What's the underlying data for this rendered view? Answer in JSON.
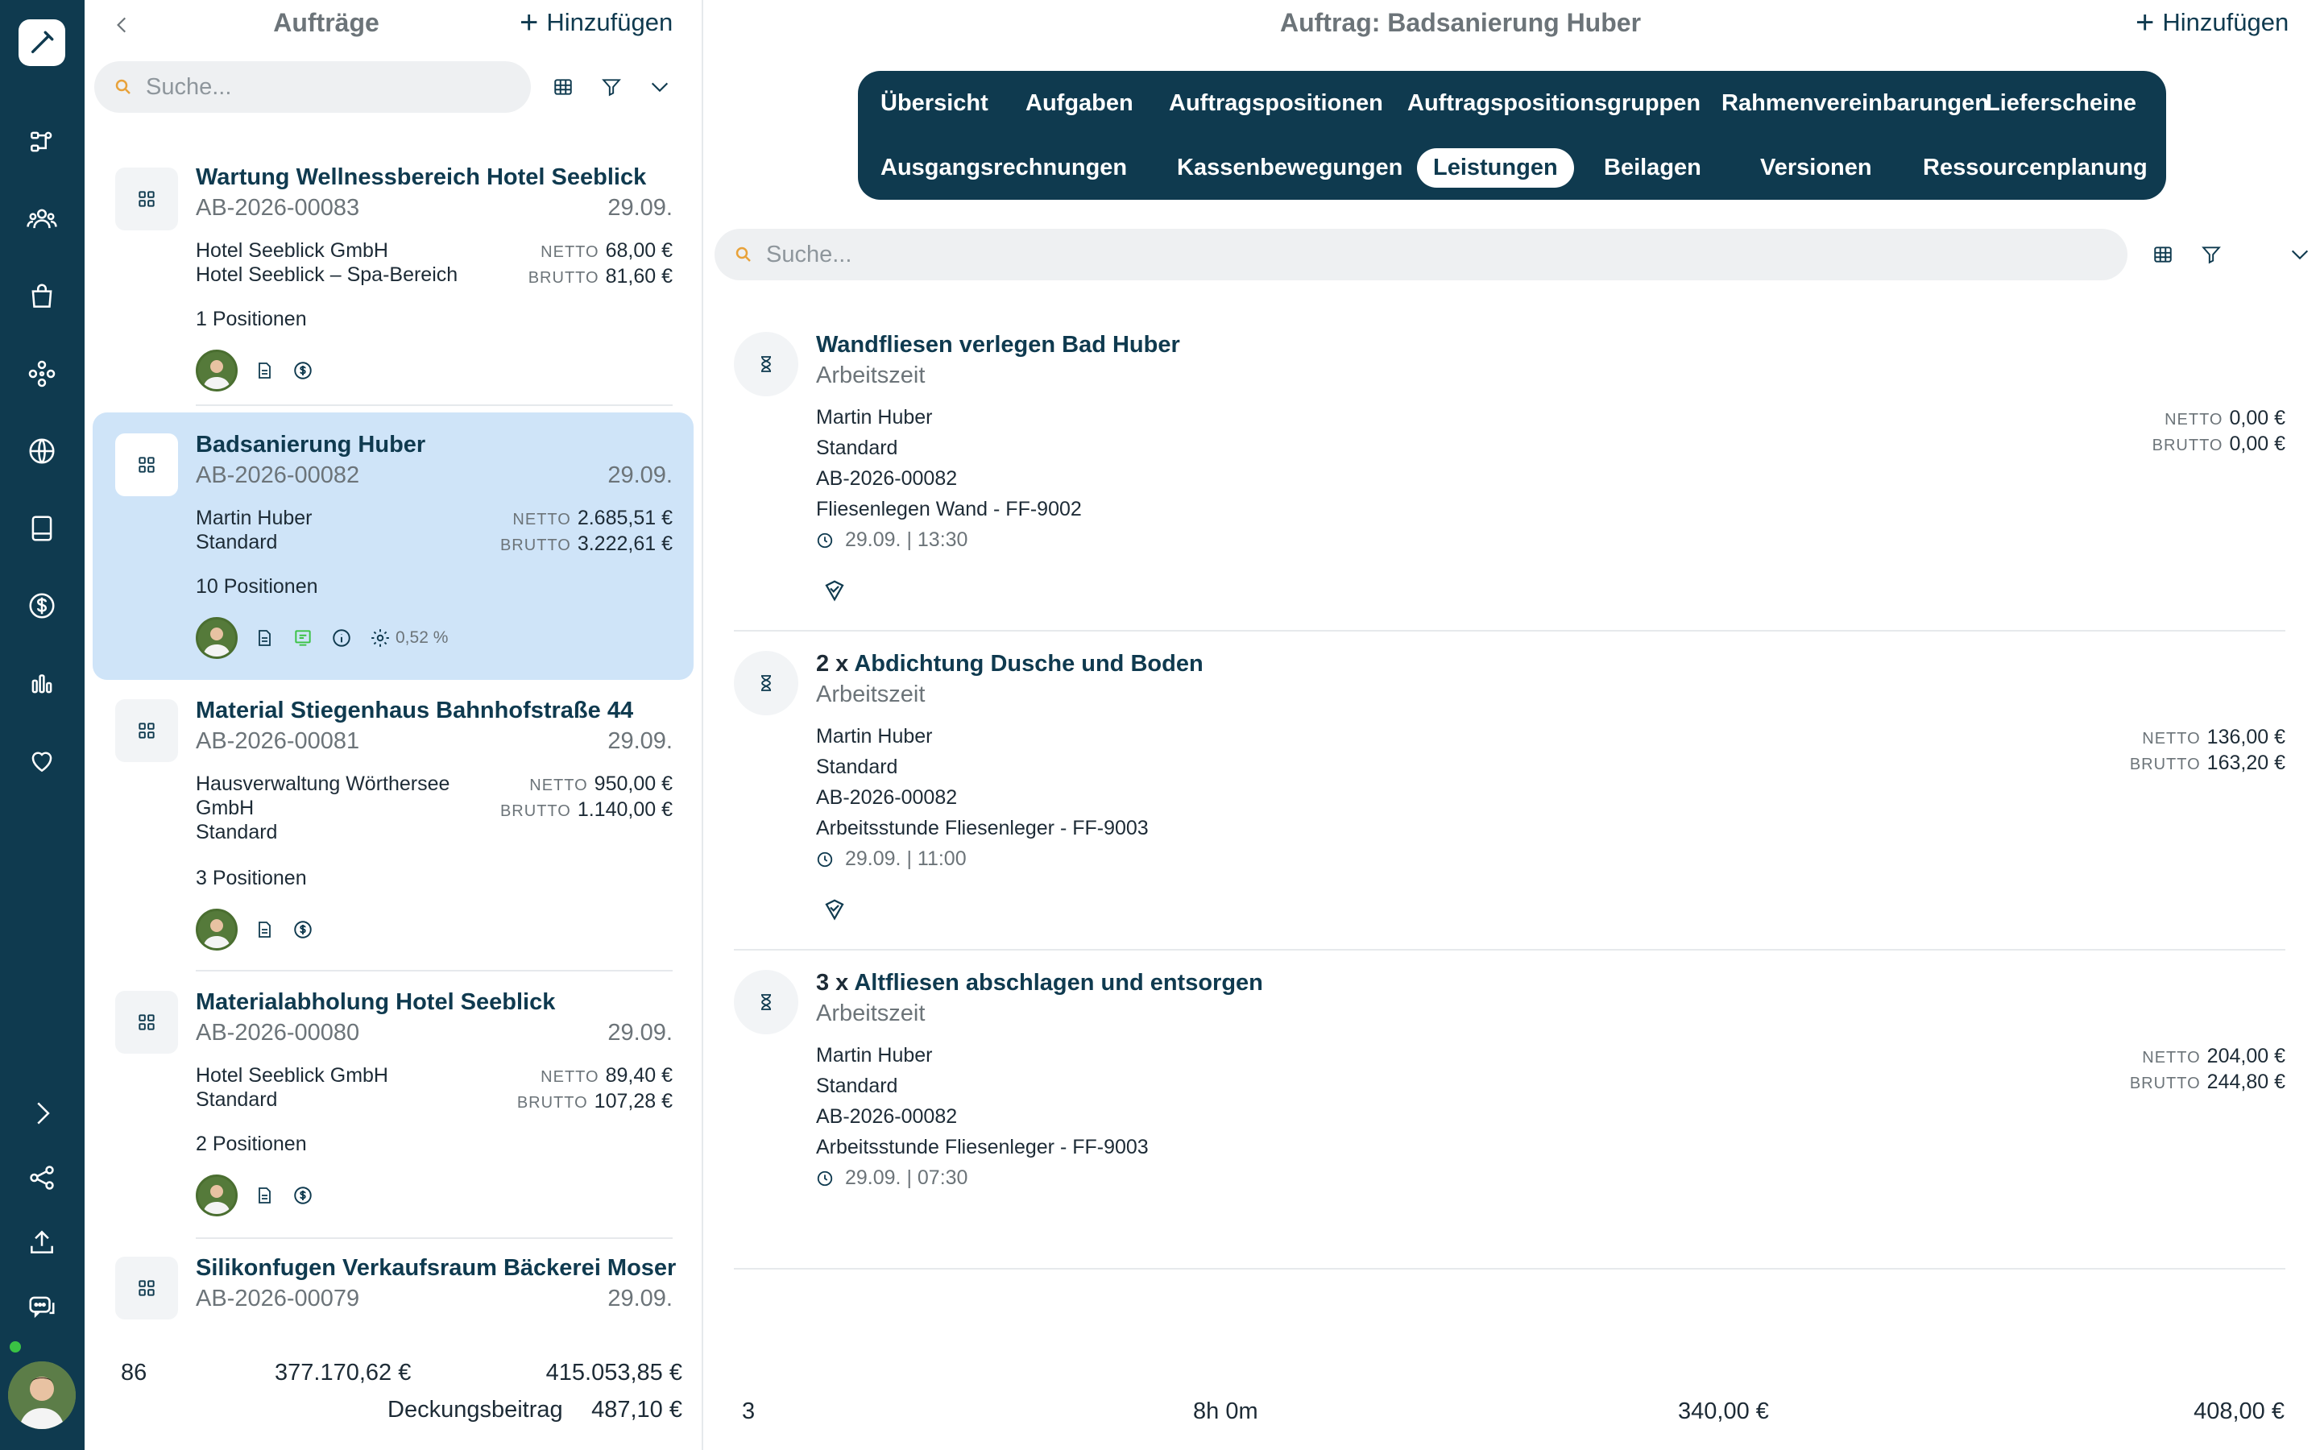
{
  "rail": {
    "icons": [
      "edit-icon",
      "workflow-icon",
      "users-icon",
      "bag-icon",
      "modules-icon",
      "globe-icon",
      "document-icon",
      "dollar-icon",
      "chart-icon",
      "heart-icon"
    ],
    "bottom_icons": [
      "expand-icon",
      "share-icon",
      "upload-icon",
      "chat-icon"
    ]
  },
  "list": {
    "title": "Aufträge",
    "add_label": "Hinzufügen",
    "search_placeholder": "Suche...",
    "orders": [
      {
        "title": "Wartung Wellnessbereich Hotel Seeblick",
        "number": "AB-2026-00083",
        "date": "29.09.",
        "lines": [
          "Hotel Seeblick GmbH",
          "Hotel Seeblick – Spa-Bereich"
        ],
        "netto": "68,00 €",
        "brutto": "81,60 €",
        "positions": "1 Positionen"
      },
      {
        "title": "Badsanierung Huber",
        "number": "AB-2026-00082",
        "date": "29.09.",
        "lines": [
          "Martin Huber",
          "Standard"
        ],
        "netto": "2.685,51 €",
        "brutto": "3.222,61 €",
        "positions": "10 Positionen",
        "percent": "0,52 %"
      },
      {
        "title": "Material Stiegenhaus Bahnhofstraße 44",
        "number": "AB-2026-00081",
        "date": "29.09.",
        "lines": [
          "Hausverwaltung Wörthersee",
          "GmbH",
          "Standard"
        ],
        "netto": "950,00 €",
        "brutto": "1.140,00 €",
        "positions": "3 Positionen"
      },
      {
        "title": "Materialabholung Hotel Seeblick",
        "number": "AB-2026-00080",
        "date": "29.09.",
        "lines": [
          "Hotel Seeblick GmbH",
          "Standard"
        ],
        "netto": "89,40 €",
        "brutto": "107,28 €",
        "positions": "2 Positionen"
      },
      {
        "title": "Silikonfugen Verkaufsraum Bäckerei Moser",
        "number": "AB-2026-00079",
        "date": "29.09."
      }
    ],
    "labels": {
      "netto": "NETTO",
      "brutto": "BRUTTO"
    },
    "footer": {
      "count": "86",
      "netto_total": "377.170,62 €",
      "brutto_total": "415.053,85 €",
      "margin_label": "Deckungsbeitrag",
      "margin_value": "487,10 €"
    }
  },
  "detail": {
    "title": "Auftrag: Badsanierung Huber",
    "add_label": "Hinzufügen",
    "search_placeholder": "Suche...",
    "tabs_row1": [
      "Übersicht",
      "Aufgaben",
      "Auftragspositionen",
      "Auftragspositionsgruppen",
      "Rahmenvereinbarungen",
      "Lieferscheine"
    ],
    "tabs_row2": [
      "Ausgangsrechnungen",
      "Kassenbewegungen",
      "Leistungen",
      "Beilagen",
      "Versionen",
      "Ressourcenplanung"
    ],
    "active_tab": "Leistungen",
    "entries": [
      {
        "qty": "",
        "title": "Wandfliesen verlegen Bad Huber",
        "type": "Arbeitszeit",
        "person": "Martin Huber",
        "variant": "Standard",
        "order": "AB-2026-00082",
        "article": "Fliesenlegen Wand - FF-9002",
        "time": "29.09. | 13:30",
        "netto": "0,00 €",
        "brutto": "0,00 €"
      },
      {
        "qty": "2 x",
        "title": "Abdichtung Dusche und Boden",
        "type": "Arbeitszeit",
        "person": "Martin Huber",
        "variant": "Standard",
        "order": "AB-2026-00082",
        "article": "Arbeitsstunde Fliesenleger - FF-9003",
        "time": "29.09. | 11:00",
        "netto": "136,00 €",
        "brutto": "163,20 €"
      },
      {
        "qty": "3 x",
        "title": "Altfliesen abschlagen und entsorgen",
        "type": "Arbeitszeit",
        "person": "Martin Huber",
        "variant": "Standard",
        "order": "AB-2026-00082",
        "article": "Arbeitsstunde Fliesenleger - FF-9003",
        "time": "29.09. | 07:30",
        "netto": "204,00 €",
        "brutto": "244,80 €"
      }
    ],
    "footer": {
      "count": "3",
      "duration": "8h 0m",
      "netto_total": "340,00 €",
      "brutto_total": "408,00 €"
    }
  },
  "colors": {
    "primary": "#0f3a4f",
    "selected": "#cfe4f8",
    "status": "#3ac244",
    "search_accent": "#e8a23a"
  }
}
